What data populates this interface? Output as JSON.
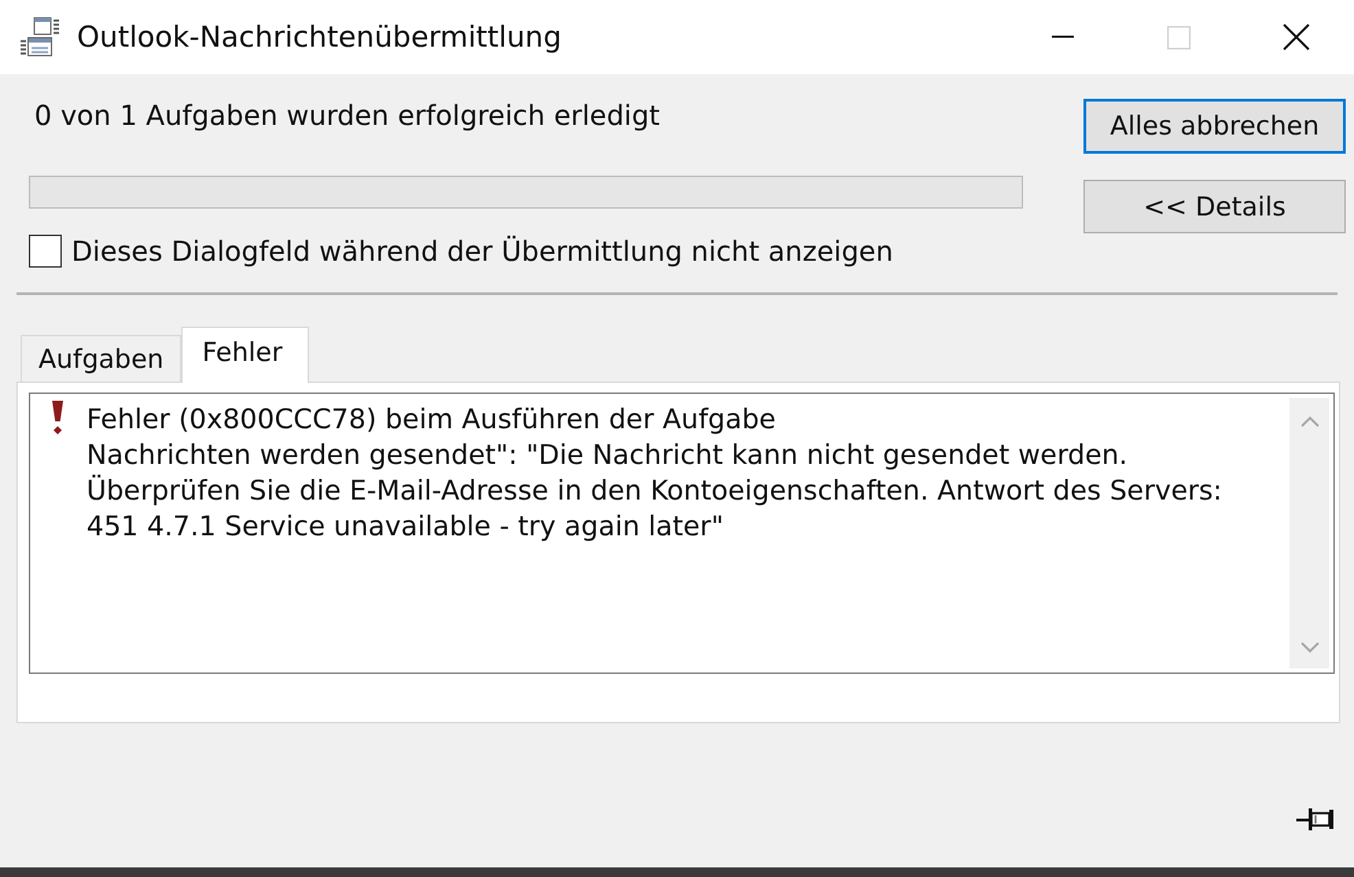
{
  "window": {
    "title": "Outlook-Nachrichtenübermittlung",
    "controls": [
      {
        "kind": "minimize",
        "disabled": false
      },
      {
        "kind": "maximize",
        "disabled": true
      },
      {
        "kind": "close",
        "disabled": false
      }
    ]
  },
  "status": {
    "text": "0 von 1 Aufgaben wurden erfolgreich erledigt"
  },
  "progress": {
    "level": 0
  },
  "hide_dialog_checkbox": {
    "label": "Dieses Dialogfeld während der Übermittlung nicht anzeigen",
    "checked": false
  },
  "buttons": [
    {
      "label": "Alles abbrechen",
      "default": true
    },
    {
      "label": "<< Details",
      "default": false
    }
  ],
  "tabs": [
    {
      "label": "Aufgaben",
      "selected": false
    },
    {
      "label": "Fehler",
      "selected": true
    }
  ],
  "errors": [
    {
      "lines": [
        "Fehler (0x800CCC78) beim Ausführen der Aufgabe",
        "Nachrichten werden gesendet\": \"Die Nachricht kann nicht gesendet werden.",
        "Überprüfen Sie die E-Mail-Adresse in den Kontoeigenschaften. Antwort des Servers:",
        "451 4.7.1 Service unavailable - try again later\""
      ]
    }
  ]
}
